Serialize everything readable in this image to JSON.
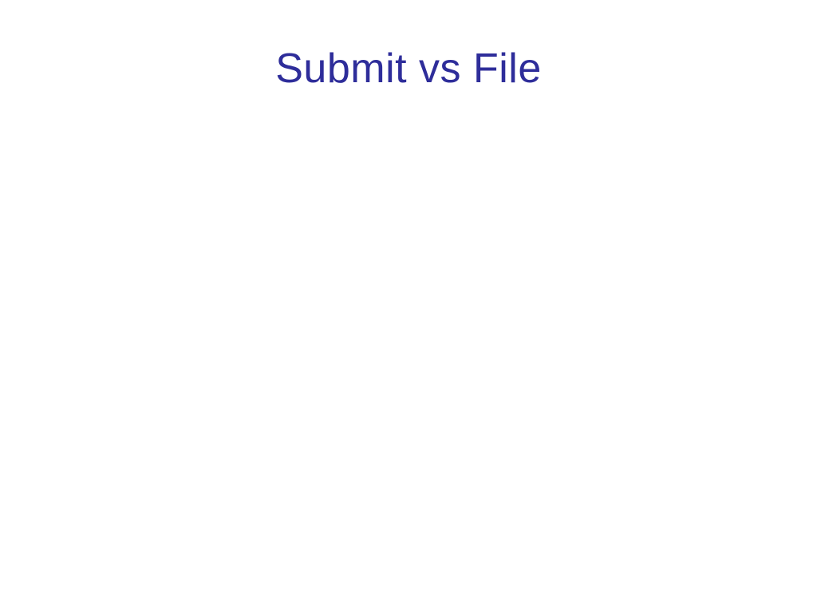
{
  "slide": {
    "title": "Submit vs File"
  }
}
